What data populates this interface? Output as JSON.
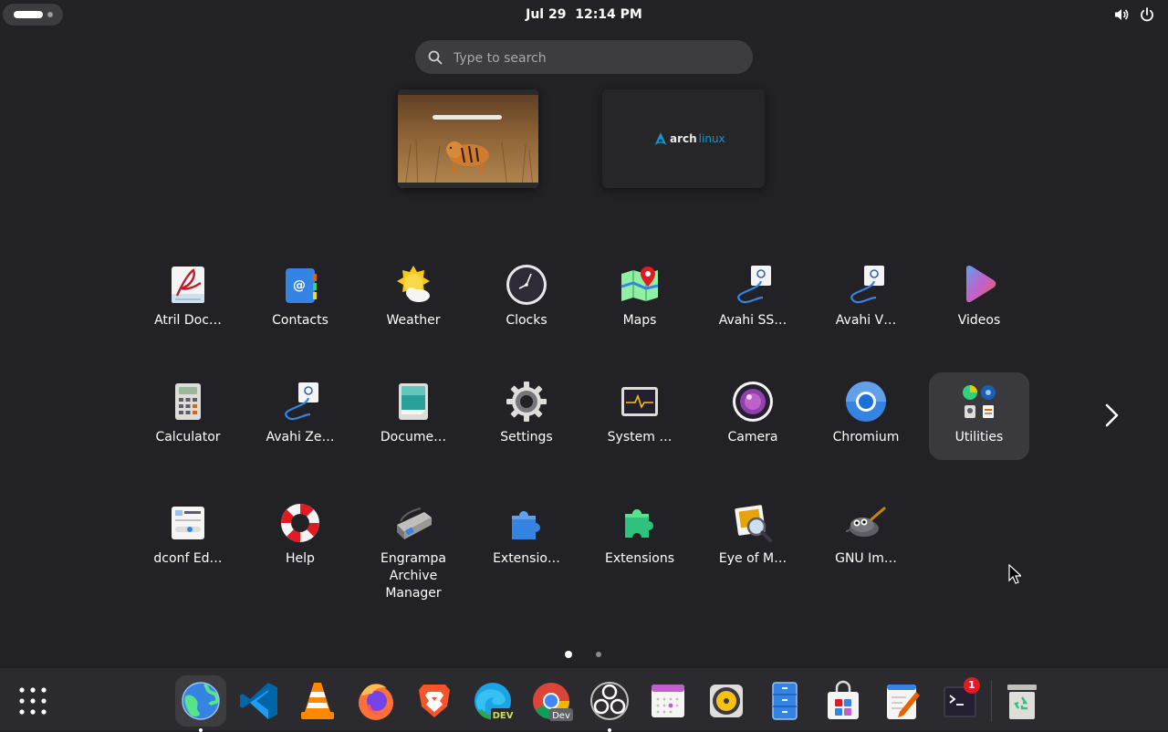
{
  "topbar": {
    "date": "Jul 29",
    "time": "12:14 PM",
    "activities_icon": "activities-pill-icon",
    "status_icons": [
      "volume-icon",
      "power-icon"
    ]
  },
  "search": {
    "placeholder": "Type to search",
    "value": ""
  },
  "workspaces": [
    {
      "name": "workspace-1",
      "content": "browser-window-tiger-wallpaper"
    },
    {
      "name": "workspace-2",
      "logo_text_a": "arch",
      "logo_text_b": "linux"
    }
  ],
  "apps": [
    {
      "label": "Atril Doc…",
      "icon": "atril-icon"
    },
    {
      "label": "Contacts",
      "icon": "contacts-icon"
    },
    {
      "label": "Weather",
      "icon": "weather-icon"
    },
    {
      "label": "Clocks",
      "icon": "clocks-icon"
    },
    {
      "label": "Maps",
      "icon": "maps-icon"
    },
    {
      "label": "Avahi SS…",
      "icon": "avahi-icon"
    },
    {
      "label": "Avahi V…",
      "icon": "avahi-icon"
    },
    {
      "label": "Videos",
      "icon": "videos-icon"
    },
    {
      "label": "Calculator",
      "icon": "calculator-icon"
    },
    {
      "label": "Avahi Ze…",
      "icon": "avahi-icon"
    },
    {
      "label": "Docume…",
      "icon": "document-scanner-icon"
    },
    {
      "label": "Settings",
      "icon": "settings-gear-icon"
    },
    {
      "label": "System …",
      "icon": "system-monitor-icon"
    },
    {
      "label": "Camera",
      "icon": "camera-icon"
    },
    {
      "label": "Chromium",
      "icon": "chromium-icon"
    },
    {
      "label": "Utilities",
      "icon": "utilities-folder-icon"
    },
    {
      "label": "dconf Ed…",
      "icon": "dconf-editor-icon"
    },
    {
      "label": "Help",
      "icon": "help-lifebuoy-icon"
    },
    {
      "label": "Engrampa\nArchive\nManager",
      "icon": "engrampa-icon"
    },
    {
      "label": "Extensio…",
      "icon": "extensions-blue-icon"
    },
    {
      "label": "Extensions",
      "icon": "extensions-green-icon"
    },
    {
      "label": "Eye of M…",
      "icon": "eye-of-mate-icon"
    },
    {
      "label": "GNU Im…",
      "icon": "gimp-icon"
    }
  ],
  "pager": {
    "pages": 2,
    "current": 1
  },
  "dash": {
    "items": [
      {
        "icon": "show-apps-grid-icon"
      },
      {
        "icon": "web-browser-icon",
        "running": true
      },
      {
        "icon": "vscode-icon"
      },
      {
        "icon": "vlc-icon"
      },
      {
        "icon": "firefox-icon"
      },
      {
        "icon": "brave-icon"
      },
      {
        "icon": "edge-dev-icon",
        "badge_text": "DEV"
      },
      {
        "icon": "chrome-dev-icon",
        "badge_text": "Dev"
      },
      {
        "icon": "obs-icon",
        "running": true
      },
      {
        "icon": "calendar-icon"
      },
      {
        "icon": "rhythmbox-icon"
      },
      {
        "icon": "file-cabinet-icon"
      },
      {
        "icon": "software-store-icon"
      },
      {
        "icon": "text-editor-icon"
      },
      {
        "icon": "terminal-icon",
        "notifications": "1"
      },
      {
        "icon": "trash-icon"
      }
    ]
  },
  "colors": {
    "background": "#222226",
    "dash": "#2b2b2f",
    "search_bg": "#3d3d41",
    "accent_blue": "#3584e4"
  }
}
